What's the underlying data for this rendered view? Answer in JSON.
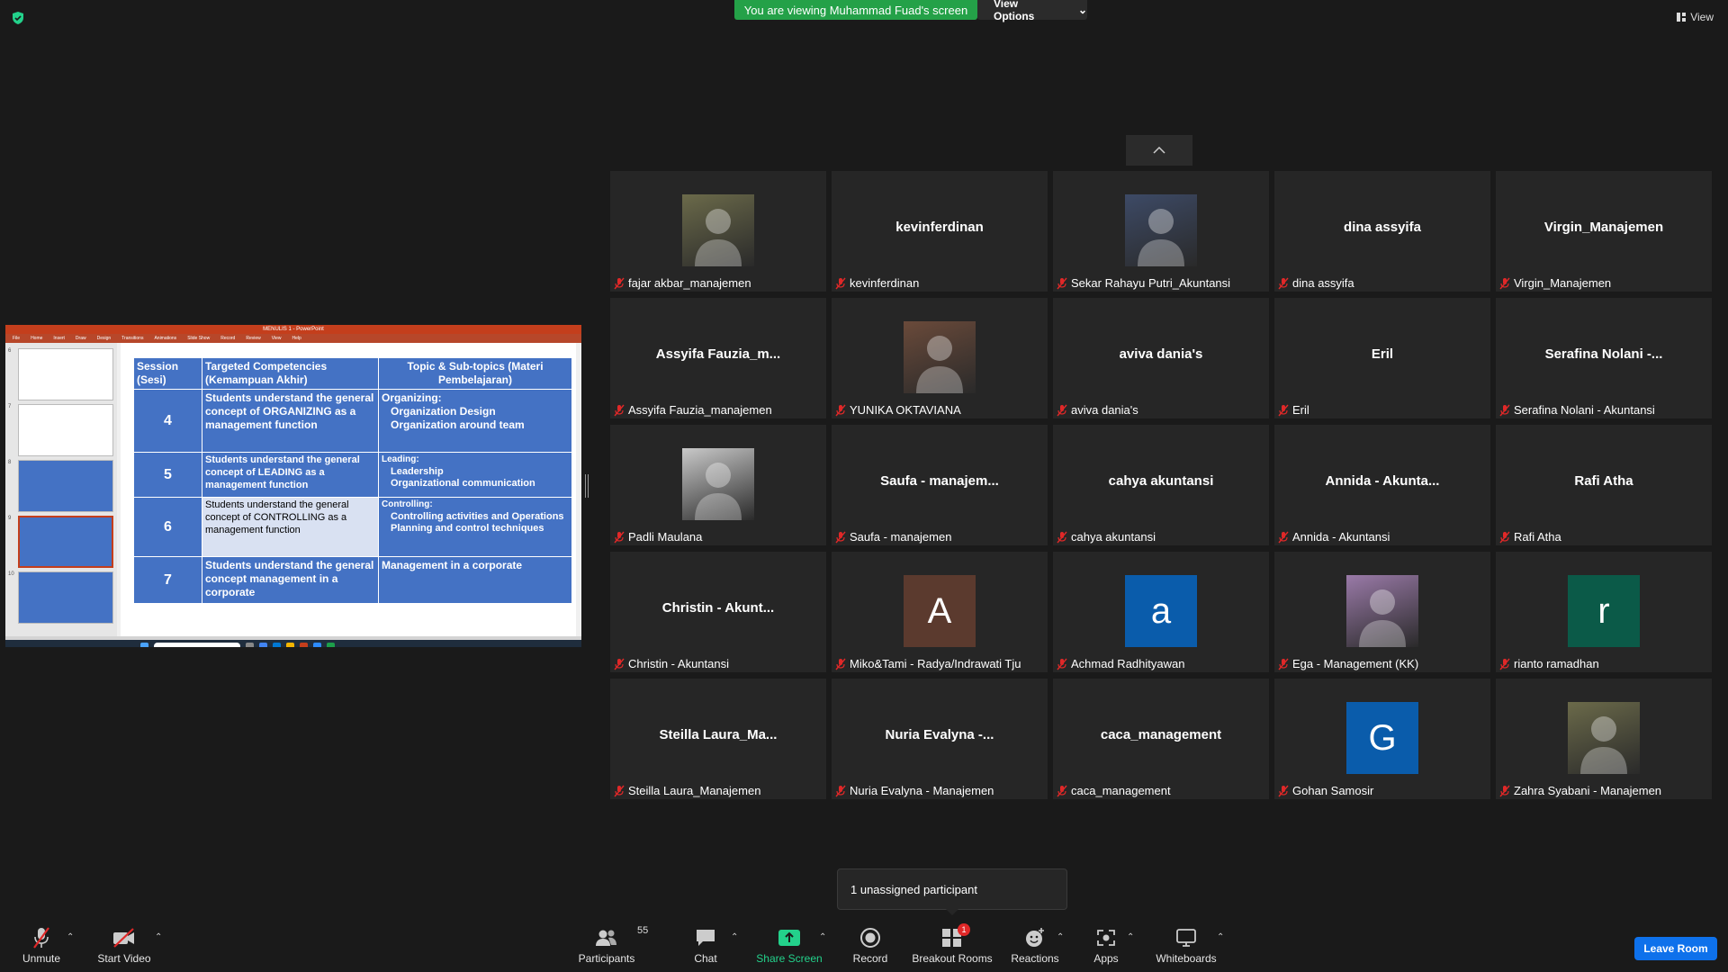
{
  "top": {
    "banner": "You are viewing Muhammad Fuad's screen",
    "view_options": "View Options",
    "view_label": "View"
  },
  "shared_screen": {
    "ppt_title": "MENULIS 1 - PowerPoint",
    "ribbon_tabs": [
      "File",
      "Home",
      "Insert",
      "Draw",
      "Design",
      "Transitions",
      "Animations",
      "Slide Show",
      "Record",
      "Review",
      "View",
      "Help"
    ],
    "thumb_numbers": [
      "6",
      "7",
      "8",
      "9",
      "10"
    ],
    "table": {
      "headers": {
        "session": "Session (Sesi)",
        "competency": "Targeted Competencies (Kemampuan Akhir)",
        "topic": "Topic & Sub-topics (Materi Pembelajaran)"
      },
      "rows": [
        {
          "session": "4",
          "competency": "Students understand the general concept of ORGANIZING as a management function",
          "topic_head": "Organizing:",
          "subtopics": [
            "Organization Design",
            "Organization around team"
          ]
        },
        {
          "session": "5",
          "competency": "Students understand the general concept of LEADING as a management function",
          "topic_head": "Leading:",
          "subtopics": [
            "Leadership",
            "Organizational communication"
          ]
        },
        {
          "session": "6",
          "competency": "Students understand the general concept of CONTROLLING as a management function",
          "topic_head": "Controlling:",
          "subtopics": [
            "Controlling activities and Operations",
            "Planning and control techniques"
          ]
        },
        {
          "session": "7",
          "competency": "Students understand the general concept management in a corporate",
          "topic_head": "Management in a corporate",
          "subtopics": []
        }
      ]
    }
  },
  "participants_tiles": [
    {
      "display": "",
      "label": "fajar akbar_manajemen",
      "kind": "photo"
    },
    {
      "display": "kevinferdinan",
      "label": "kevinferdinan",
      "kind": "name"
    },
    {
      "display": "",
      "label": "Sekar Rahayu Putri_Akuntansi",
      "kind": "photo"
    },
    {
      "display": "dina assyifa",
      "label": "dina assyifa",
      "kind": "name"
    },
    {
      "display": "Virgin_Manajemen",
      "label": "Virgin_Manajemen",
      "kind": "name"
    },
    {
      "display": "Assyifa  Fauzia_m...",
      "label": "Assyifa Fauzia_manajemen",
      "kind": "name"
    },
    {
      "display": "",
      "label": "YUNIKA OKTAVIANA",
      "kind": "photo"
    },
    {
      "display": "aviva dania's",
      "label": "aviva dania's",
      "kind": "name"
    },
    {
      "display": "Eril",
      "label": "Eril",
      "kind": "name"
    },
    {
      "display": "Serafina Nolani -...",
      "label": "Serafina Nolani - Akuntansi",
      "kind": "name"
    },
    {
      "display": "",
      "label": "Padli Maulana",
      "kind": "photo"
    },
    {
      "display": "Saufa  -  manajem...",
      "label": "Saufa - manajemen",
      "kind": "name"
    },
    {
      "display": "cahya akuntansi",
      "label": "cahya akuntansi",
      "kind": "name"
    },
    {
      "display": "Annida  -  Akunta...",
      "label": "Annida - Akuntansi",
      "kind": "name"
    },
    {
      "display": "Rafi Atha",
      "label": "Rafi Atha",
      "kind": "name"
    },
    {
      "display": "Christin   -  Akunt...",
      "label": "Christin  - Akuntansi",
      "kind": "name"
    },
    {
      "display": "A",
      "label": "Miko&Tami - Radya/Indrawati Tju",
      "kind": "avatar",
      "color": "#5b3a2e"
    },
    {
      "display": "a",
      "label": "Achmad Radhityawan",
      "kind": "avatar",
      "color": "#0a5cab"
    },
    {
      "display": "",
      "label": "Ega - Management (KK)",
      "kind": "photo"
    },
    {
      "display": "r",
      "label": "rianto ramadhan",
      "kind": "avatar",
      "color": "#0b5a48"
    },
    {
      "display": "Steilla  Laura_Ma...",
      "label": "Steilla Laura_Manajemen",
      "kind": "name"
    },
    {
      "display": "Nuria  Evalyna  -...",
      "label": "Nuria Evalyna - Manajemen",
      "kind": "name"
    },
    {
      "display": "caca_management",
      "label": "caca_management",
      "kind": "name"
    },
    {
      "display": "G",
      "label": "Gohan Samosir",
      "kind": "avatar",
      "color": "#0a5cab"
    },
    {
      "display": "",
      "label": "Zahra Syabani - Manajemen",
      "kind": "photo"
    }
  ],
  "popup": {
    "unassigned": "1 unassigned participant"
  },
  "toolbar": {
    "unmute": "Unmute",
    "start_video": "Start Video",
    "participants": "Participants",
    "participants_count": "55",
    "chat": "Chat",
    "share_screen": "Share Screen",
    "record": "Record",
    "breakout_rooms": "Breakout Rooms",
    "breakout_badge": "1",
    "reactions": "Reactions",
    "apps": "Apps",
    "whiteboards": "Whiteboards",
    "leave_room": "Leave Room"
  },
  "colors": {
    "share_green": "#23d18b",
    "banner_green": "#24a148",
    "leave_blue": "#0e71eb",
    "mute_red": "#e02828"
  }
}
